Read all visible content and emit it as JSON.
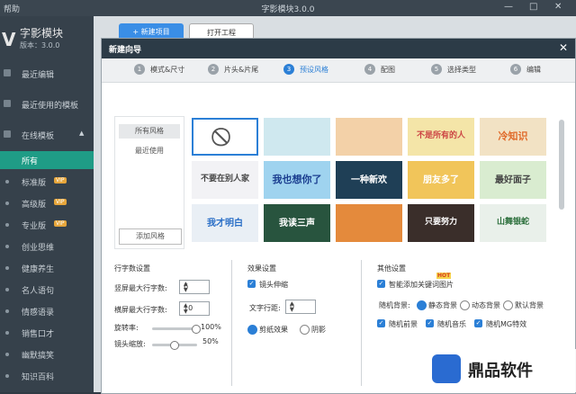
{
  "titlebar": {
    "menu": "帮助",
    "title": "字影模块3.0.0",
    "min": "—",
    "max": "□",
    "close": "✕"
  },
  "sidebar": {
    "logo": "V",
    "app_name": "字影模块",
    "version": "版本：3.0.0",
    "items": [
      {
        "label": "最近编辑"
      },
      {
        "label": "最近使用的模板"
      },
      {
        "label": "在线模板",
        "expand": "▲"
      }
    ],
    "sub_items": [
      {
        "label": "所有",
        "selected": true
      },
      {
        "label": "标准版",
        "vip": "VIP"
      },
      {
        "label": "高级版",
        "vip": "VIP"
      },
      {
        "label": "专业版",
        "vip": "VIP"
      },
      {
        "label": "创业思维"
      },
      {
        "label": "健康养生"
      },
      {
        "label": "名人语句"
      },
      {
        "label": "情感语录"
      },
      {
        "label": "销售口才"
      },
      {
        "label": "幽默搞笑"
      },
      {
        "label": "知识百科"
      }
    ]
  },
  "toolbar": {
    "new_project": "+ 新建项目",
    "open_project": "打开工程"
  },
  "dialog": {
    "title": "新建向导",
    "close": "✕",
    "steps": [
      {
        "num": "1",
        "label": "模式&尺寸"
      },
      {
        "num": "2",
        "label": "片头&片尾"
      },
      {
        "num": "3",
        "label": "预设风格",
        "active": true
      },
      {
        "num": "4",
        "label": "配图"
      },
      {
        "num": "5",
        "label": "选择类型"
      },
      {
        "num": "6",
        "label": "编辑"
      }
    ],
    "categories": [
      {
        "label": "所有风格",
        "selected": true
      },
      {
        "label": "最近使用"
      }
    ],
    "add_style": "添加风格",
    "tiles": [
      {
        "caption": "⃠",
        "bg": "#ffffff"
      },
      {
        "caption": "",
        "bg": "#cfe8ef"
      },
      {
        "caption": "",
        "bg": "#f3d1a8"
      },
      {
        "caption": "不是所有的人",
        "bg": "#f4e5a8"
      },
      {
        "caption": "冷知识",
        "bg": "#f2e2c4"
      },
      {
        "caption": "不要在别人家",
        "bg": "#f2f2f5"
      },
      {
        "caption": "我也想你了",
        "bg": "#9fd3ef"
      },
      {
        "caption": "一种新欢",
        "bg": "#1f3f56"
      },
      {
        "caption": "朋友多了",
        "bg": "#f1c55a"
      },
      {
        "caption": "最好面子",
        "bg": "#d9ecd0"
      },
      {
        "caption": "我才明白",
        "bg": "#e9eff5"
      },
      {
        "caption": "我读三声",
        "bg": "#28543e"
      },
      {
        "caption": "",
        "bg": "#e48a3c"
      },
      {
        "caption": "只要努力",
        "bg": "#3a2e2a"
      },
      {
        "caption": "山舞银蛇",
        "bg": "#e9f0ea"
      }
    ],
    "word_settings": {
      "title": "行字数设置",
      "vertical_label": "竖屏最大行字数:",
      "vertical_value": "6",
      "horizontal_label": "横屏最大行字数:",
      "horizontal_value": "10",
      "rotate_label": "旋转率:",
      "rotate_value": "100%",
      "rotate_level": 1.0,
      "zoom_label": "镜头缩放:",
      "zoom_value": "50%",
      "zoom_level": 0.5
    },
    "effects": {
      "title": "效果设置",
      "lens_shake": "镜头伸缩",
      "spacing_label": "文字行距:",
      "spacing_value": "0",
      "paper_effect": "剪纸效果",
      "shadow": "阴影"
    },
    "other": {
      "title": "其他设置",
      "hot": "HOT",
      "smart_images": "智能添加关键词图片",
      "random_bg_label": "随机背景:",
      "static_bg": "静态背景",
      "dynamic_bg": "动态背景",
      "default_bg": "默认背景",
      "random_fg": "随机前景",
      "random_music": "随机音乐",
      "random_mg": "随机MG特效"
    }
  },
  "watermark": {
    "text": "鼎品软件"
  }
}
